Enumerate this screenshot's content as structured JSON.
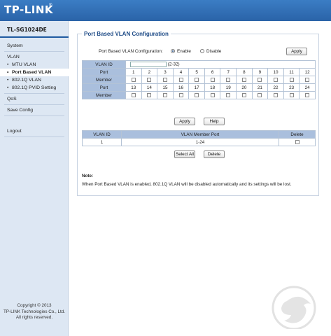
{
  "header": {
    "brand": "TP-LINK",
    "brand_mark": "®"
  },
  "sidebar": {
    "model": "TL-SG1024DE",
    "items": [
      {
        "label": "System",
        "sub": false,
        "active": false
      },
      {
        "label": "VLAN",
        "sub": false,
        "active": false
      },
      {
        "label": "MTU VLAN",
        "sub": true,
        "active": false
      },
      {
        "label": "Port Based VLAN",
        "sub": true,
        "active": true
      },
      {
        "label": "802.1Q VLAN",
        "sub": true,
        "active": false
      },
      {
        "label": "802.1Q PVID Setting",
        "sub": true,
        "active": false
      },
      {
        "label": "QoS",
        "sub": false,
        "active": false
      },
      {
        "label": "Save Config",
        "sub": false,
        "active": false
      },
      {
        "label": "Logout",
        "sub": false,
        "active": false
      }
    ],
    "footer": [
      "Copyright © 2013",
      "TP-LINK Technologies Co., Ltd.",
      "All rights reserved."
    ]
  },
  "panel": {
    "title": "Port Based VLAN Configuration",
    "config_label": "Port Based VLAN Configuration:",
    "enable_label": "Enable",
    "disable_label": "Disable",
    "enabled": true,
    "apply_label": "Apply",
    "vlan_id_label": "VLAN ID",
    "vlan_id_value": "",
    "vlan_id_range": "(2-32)",
    "port_label": "Port",
    "member_label": "Member",
    "ports_row1": [
      "1",
      "2",
      "3",
      "4",
      "5",
      "6",
      "7",
      "8",
      "9",
      "10",
      "11",
      "12"
    ],
    "ports_row2": [
      "13",
      "14",
      "15",
      "16",
      "17",
      "18",
      "19",
      "20",
      "21",
      "22",
      "23",
      "24"
    ],
    "apply_button": "Apply",
    "help_button": "Help",
    "table": {
      "headers": [
        "VLAN ID",
        "VLAN Member Port",
        "Delete"
      ],
      "rows": [
        {
          "vlan_id": "1",
          "members": "1-24"
        }
      ]
    },
    "select_all_button": "Select All",
    "delete_button": "Delete",
    "note_title": "Note:",
    "note_text": "When Port Based VLAN is enabled, 802.1Q VLAN will be disabled automatically and its settings will be lost."
  },
  "colors": {
    "header_blue": "#2d6fb6",
    "sidebar_bg": "#dde7f3",
    "table_header": "#aabfdd"
  }
}
